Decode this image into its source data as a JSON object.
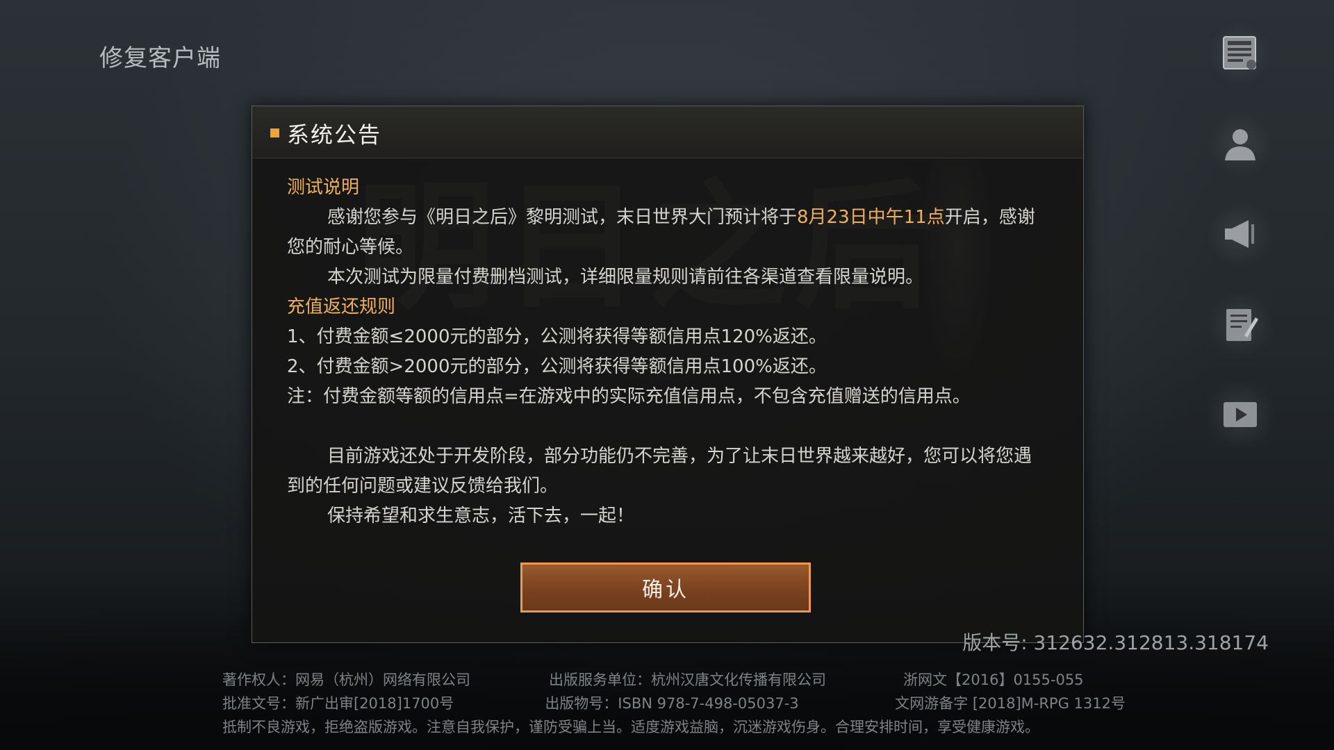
{
  "top_left": {
    "repair_label": "修复客户端"
  },
  "side_menu": {
    "icons": [
      "news-icon",
      "account-icon",
      "announcement-icon",
      "survey-icon",
      "video-icon"
    ]
  },
  "dialog": {
    "title": "系统公告",
    "sections": {
      "test_title": "测试说明",
      "test_p1_before": "感谢您参与《明日之后》黎明测试，末日世界大门预计将于",
      "test_p1_highlight": "8月23日中午11点",
      "test_p1_after": "开启，感谢您的耐心等候。",
      "test_p2": "本次测试为限量付费删档测试，详细限量规则请前往各渠道查看限量说明。",
      "refund_title": "充值返还规则",
      "refund_1": "1、付费金额≤2000元的部分，公测将获得等额信用点120%返还。",
      "refund_2": "2、付费金额>2000元的部分，公测将获得等额信用点100%返还。",
      "refund_note": "注：付费金额等额的信用点=在游戏中的实际充值信用点，不包含充值赠送的信用点。",
      "closing_p1": "目前游戏还处于开发阶段，部分功能仍不完善，为了让末日世界越来越好，您可以将您遇到的任何问题或建议反馈给我们。",
      "closing_p2": "保持希望和求生意志，活下去，一起！"
    },
    "confirm_label": "确认"
  },
  "version": "版本号: 312632.312813.318174",
  "footer": {
    "copyright": "著作权人：网易（杭州）网络有限公司",
    "publisher": "出版服务单位：杭州汉唐文化传播有限公司",
    "license_zj": "浙网文【2016】0155-055",
    "approval": "批准文号：新广出审[2018]1700号",
    "isbn": "出版物号：ISBN 978-7-498-05037-3",
    "record": "文网游备字 [2018]M-RPG 1312号",
    "health_notice": "抵制不良游戏，拒绝盗版游戏。注意自我保护，谨防受骗上当。适度游戏益脑，沉迷游戏伤身。合理安排时间，享受健康游戏。"
  },
  "colors": {
    "accent": "#f0a332",
    "section_title": "#f0b05c",
    "button_border": "#e99a55",
    "button_fill": "#7d4421"
  }
}
